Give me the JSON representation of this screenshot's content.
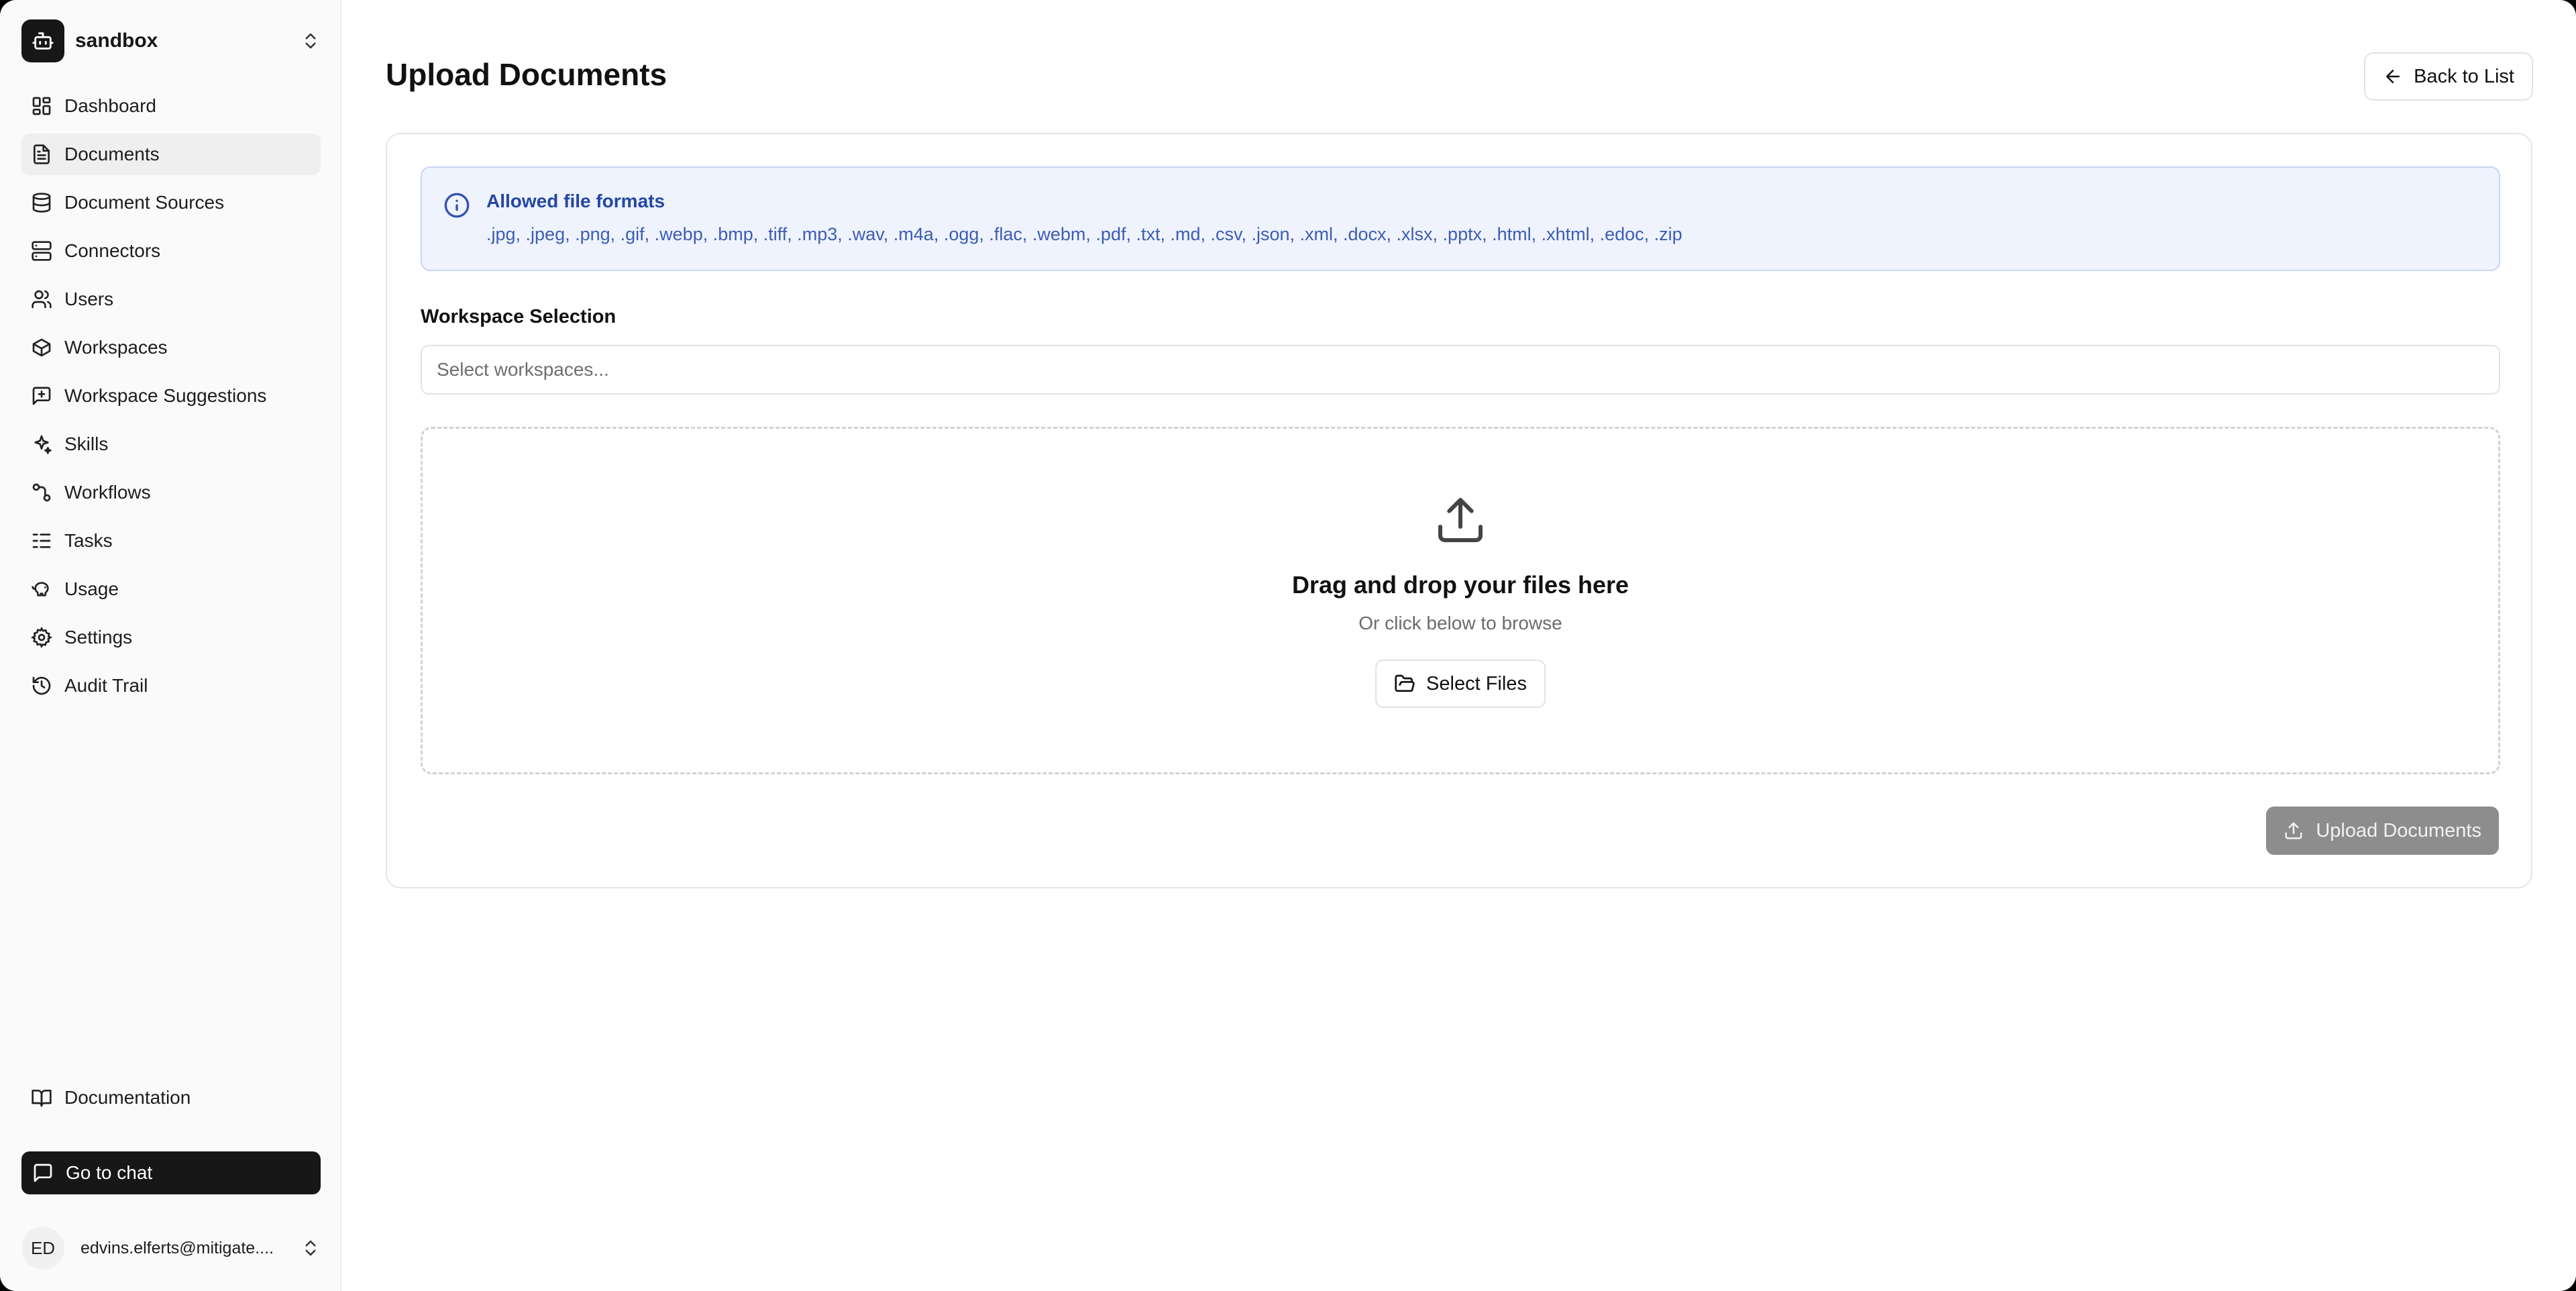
{
  "workspace": {
    "name": "sandbox"
  },
  "sidebar": {
    "items": [
      {
        "label": "Dashboard",
        "icon": "dashboard-icon"
      },
      {
        "label": "Documents",
        "icon": "file-text-icon",
        "active": true
      },
      {
        "label": "Document Sources",
        "icon": "database-icon"
      },
      {
        "label": "Connectors",
        "icon": "server-icon"
      },
      {
        "label": "Users",
        "icon": "users-icon"
      },
      {
        "label": "Workspaces",
        "icon": "box-icon"
      },
      {
        "label": "Workspace Suggestions",
        "icon": "message-plus-icon"
      },
      {
        "label": "Skills",
        "icon": "sparkles-icon"
      },
      {
        "label": "Workflows",
        "icon": "workflow-icon"
      },
      {
        "label": "Tasks",
        "icon": "list-todo-icon"
      },
      {
        "label": "Usage",
        "icon": "piggy-bank-icon"
      },
      {
        "label": "Settings",
        "icon": "gear-icon"
      },
      {
        "label": "Audit Trail",
        "icon": "history-icon"
      }
    ],
    "documentation_label": "Documentation",
    "chat_label": "Go to chat",
    "user": {
      "initials": "ED",
      "email": "edvins.elferts@mitigate...."
    }
  },
  "header": {
    "title": "Upload Documents",
    "back_label": "Back to List"
  },
  "info": {
    "title": "Allowed file formats",
    "formats": ".jpg, .jpeg, .png, .gif, .webp, .bmp, .tiff, .mp3, .wav, .m4a, .ogg, .flac, .webm, .pdf, .txt, .md, .csv, .json, .xml, .docx, .xlsx, .pptx, .html, .xhtml, .edoc, .zip"
  },
  "workspace_selection": {
    "label": "Workspace Selection",
    "placeholder": "Select workspaces...",
    "value": ""
  },
  "dropzone": {
    "title": "Drag and drop your files here",
    "subtitle": "Or click below to browse",
    "select_label": "Select Files"
  },
  "upload_label": "Upload Documents",
  "colors": {
    "accent_dark": "#171717",
    "info_bg": "#eef3fd",
    "info_text": "#2546a3",
    "upload_disabled": "#8d8d8d"
  }
}
